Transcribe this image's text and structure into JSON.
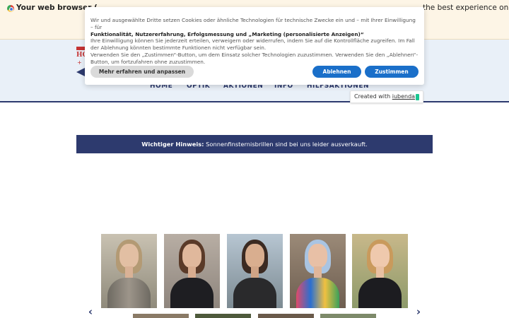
{
  "browser_warning": {
    "left_text": "Your web browser (",
    "right_text": "the best experience on"
  },
  "logo": {
    "text": "HO",
    "mark": "+"
  },
  "nav": {
    "items": [
      {
        "label": "HOME"
      },
      {
        "label": "OPTIK"
      },
      {
        "label": "AKTIONEN"
      },
      {
        "label": "INFO"
      },
      {
        "label": "HILFSAKTIONEN"
      }
    ]
  },
  "cookie_banner": {
    "line1": "Wir und ausgewählte Dritte setzen Cookies oder ähnliche Technologien für technische Zwecke ein und – mit Ihrer Einwilligung – für",
    "line2_bold": "Funktionalität, Nutzererfahrung, Erfolgsmessung und „Marketing (personalisierte Anzeigen)“",
    "line3": "Ihre Einwilligung können Sie jederzeit erteilen, verweigern oder widerrufen, indem Sie auf die Kontrollfläche zugreifen. Im Fall der Ablehnung könnten bestimmte Funktionen nicht verfügbar sein.",
    "line4": "Verwenden Sie den „Zustimmen“-Button, um dem Einsatz solcher Technologien zuzustimmen. Verwenden Sie den „Ablehnen“-Button, um fortzufahren ohne zuzustimmen.",
    "btn_more": "Mehr erfahren und anpassen",
    "btn_deny": "Ablehnen",
    "btn_accept": "Zustimmen"
  },
  "iubenda": {
    "prefix": "Created with ",
    "brand": "iubenda"
  },
  "notice": {
    "bold": "Wichtiger Hinweis:",
    "text": " Sonnenfinsternisbrillen sind bei uns leider ausverkauft."
  },
  "carousel": {
    "prev_glyph": "‹",
    "next_glyph": "›"
  },
  "colors": {
    "brand_navy": "#2d3a6e",
    "cookie_button_blue": "#1a6fc9",
    "header_bg": "#e9f0f8",
    "warning_bg": "#fdf5e6"
  }
}
